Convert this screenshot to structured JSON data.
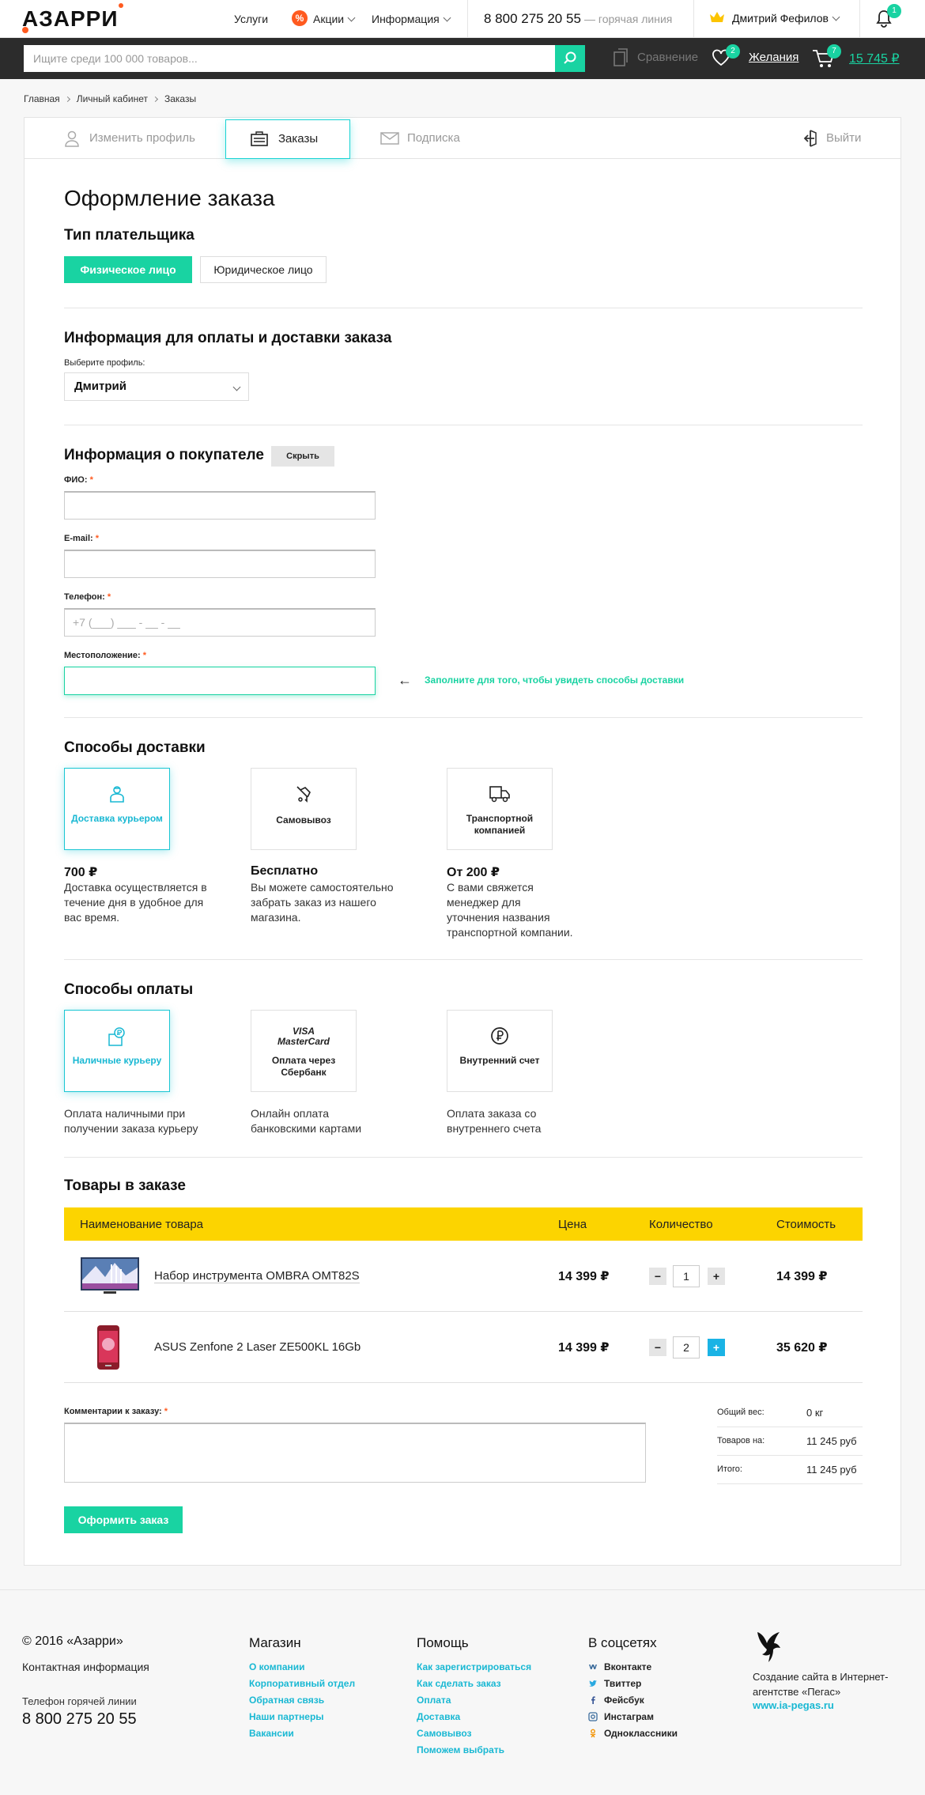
{
  "header": {
    "logo": "АЗАРРИ",
    "nav": [
      "Услуги",
      "Акции",
      "Информация"
    ],
    "promo_badge": "%",
    "phone": "8 800 275 20 55",
    "phone_note": "— горячая линия",
    "user": "Дмитрий Фефилов",
    "notifications": "1"
  },
  "toolbar": {
    "search_placeholder": "Ищите среди 100 000 товаров...",
    "compare": "Сравнение",
    "wishlist_count": "2",
    "wishlist": "Желания",
    "cart_count": "7",
    "cart_total": "15 745 ₽"
  },
  "breadcrumbs": [
    "Главная",
    "Личный кабинет",
    "Заказы"
  ],
  "tabs": {
    "profile": "Изменить профиль",
    "orders": "Заказы",
    "subscription": "Подписка",
    "logout": "Выйти"
  },
  "order": {
    "title": "Оформление заказа",
    "payer_type_title": "Тип плательщика",
    "payer_individual": "Физическое лицо",
    "payer_legal": "Юридическое лицо",
    "billing_title": "Информация для оплаты и доставки заказа",
    "profile_label": "Выберите профиль:",
    "profile_value": "Дмитрий",
    "buyer_title": "Информация о покупателе",
    "hide_button": "Скрыть",
    "fio_label": "ФИО:",
    "email_label": "E-mail:",
    "phone_label": "Телефон:",
    "phone_placeholder": "+7 (___) ___ - __ - __",
    "location_label": "Местоположение:",
    "required_mark": "*",
    "location_hint": "Заполните для того, чтобы увидеть способы доставки",
    "hint_arrow": "←"
  },
  "delivery": {
    "title": "Способы доставки",
    "options": [
      {
        "label": "Доставка курьером",
        "price": "700 ₽",
        "desc": "Доставка осуществляется в течение дня в удобное для вас время.",
        "icon": "courier-icon"
      },
      {
        "label": "Самовывоз",
        "price": "Бесплатно",
        "desc": "Вы можете самостоятельно забрать заказ из нашего магазина.",
        "icon": "pickup-icon"
      },
      {
        "label": "Транспортной компанией",
        "price": "От 200 ₽",
        "desc": "С вами свяжется менеджер для уточнения названия транспортной компании.",
        "icon": "truck-icon"
      }
    ]
  },
  "payment": {
    "title": "Способы оплаты",
    "options": [
      {
        "label": "Наличные курьеру",
        "desc": "Оплата наличными при получении заказа курьеру",
        "icon": "cash-icon"
      },
      {
        "label": "Оплата через Сбербанк",
        "desc": "Онлайн оплата банковскими картами",
        "icon": "visa-mastercard-icon",
        "logo_top": "VISA",
        "logo_bottom": "MasterCard"
      },
      {
        "label": "Внутренний счет",
        "desc": "Оплата заказа со внутреннего счета",
        "icon": "ruble-icon"
      }
    ]
  },
  "products": {
    "title": "Товары в заказе",
    "headers": [
      "Наименование товара",
      "Цена",
      "Количество",
      "Стоимость"
    ],
    "rows": [
      {
        "name": "Набор инструмента OMBRA OMT82S",
        "price": "14 399 ₽",
        "qty": "1",
        "total": "14 399 ₽",
        "image": "tv-image"
      },
      {
        "name": "ASUS Zenfone 2 Laser ZE500KL 16Gb",
        "price": "14 399 ₽",
        "qty": "2",
        "total": "35 620 ₽",
        "image": "phone-image"
      }
    ],
    "minus": "−",
    "plus": "+"
  },
  "comment_label": "Комментарии к заказу:",
  "summary": [
    {
      "label": "Общий вес:",
      "value": "0 кг"
    },
    {
      "label": "Товаров на:",
      "value": "11 245 руб"
    },
    {
      "label": "Итого:",
      "value": "11 245 руб"
    }
  ],
  "submit": "Оформить заказ",
  "footer": {
    "copyright": "© 2016 «Азарри»",
    "contact": "Контактная информация",
    "hotline_label": "Телефон горячей линии",
    "hotline": "8 800 275 20 55",
    "shop_title": "Магазин",
    "shop_links": [
      "О компании",
      "Корпоративный отдел",
      "Обратная связь",
      "Наши партнеры",
      "Вакансии"
    ],
    "help_title": "Помощь",
    "help_links": [
      "Как зарегистрироваться",
      "Как сделать заказ",
      "Оплата",
      "Доставка",
      "Самовывоз",
      "Поможем выбрать"
    ],
    "social_title": "В соцсетях",
    "social_links": [
      "Вконтакте",
      "Твиттер",
      "Фейсбук",
      "Инстаграм",
      "Одноклассники"
    ],
    "agency_text": "Создание сайта в Интернет-агентстве «Пегас»",
    "agency_link": "www.ia-pegas.ru"
  },
  "colors": {
    "accent": "#19d3a2",
    "active_blue": "#19b8d3",
    "table_header": "#fcd400",
    "promo": "#ff5a1f",
    "dark_bar": "#2c2c2c"
  }
}
